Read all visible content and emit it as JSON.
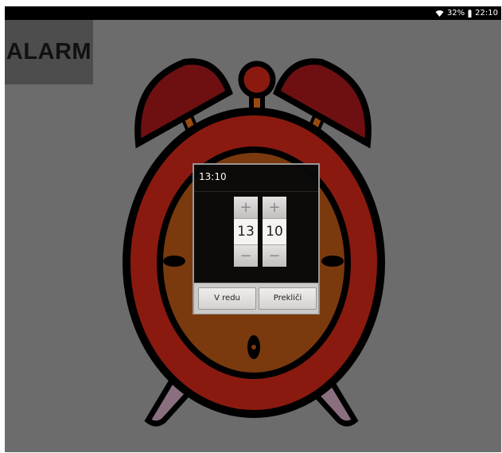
{
  "status_bar": {
    "battery": "32%",
    "time": "22:10"
  },
  "app": {
    "title": "ALARM",
    "side_mark": ":"
  },
  "dialog": {
    "title": "13:10",
    "hour": {
      "value": "13",
      "plus": "+",
      "minus": "−"
    },
    "minute": {
      "value": "10",
      "plus": "+",
      "minus": "−"
    },
    "ok_label": "V redu",
    "cancel_label": "Prekliči"
  },
  "colors": {
    "background": "#6c6c6c",
    "clock_red": "#8a1a10",
    "bell_red": "#6e1012",
    "face_brown": "#7a3a0e",
    "leg_purple": "#8a6f80"
  }
}
